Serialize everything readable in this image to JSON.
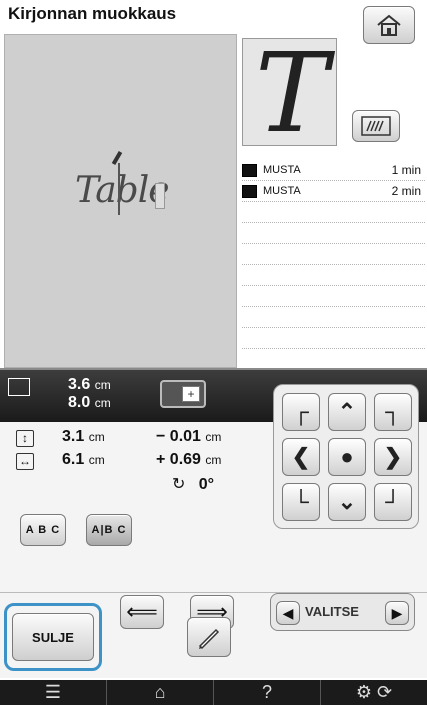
{
  "header": {
    "title": "Kirjonnan muokkaus"
  },
  "preview": {
    "text": "Table",
    "thumbnail_letter": "T"
  },
  "threads": [
    {
      "name": "MUSTA",
      "time": "1 min",
      "color": "#111111"
    },
    {
      "name": "MUSTA",
      "time": "2 min",
      "color": "#111111"
    },
    {
      "name": "",
      "time": ""
    },
    {
      "name": "",
      "time": ""
    },
    {
      "name": "",
      "time": ""
    },
    {
      "name": "",
      "time": ""
    },
    {
      "name": "",
      "time": ""
    },
    {
      "name": "",
      "time": ""
    },
    {
      "name": "",
      "time": ""
    }
  ],
  "size": {
    "height": "3.6",
    "width": "8.0",
    "unit": "cm"
  },
  "measure": {
    "row1_val": "3.1",
    "row1_unit": "cm",
    "row1_val2": "− 0.01",
    "row1_unit2": "cm",
    "row2_val": "6.1",
    "row2_unit": "cm",
    "row2_val2": "+ 0.69",
    "row2_unit2": "cm",
    "rotation": "0°"
  },
  "buttons": {
    "abc_left": "A B C",
    "abc_right": "A|B C",
    "valitse": "VALITSE",
    "sulje": "SULJE",
    "help": "?"
  },
  "icons": {
    "accent": "#3d93c8"
  }
}
